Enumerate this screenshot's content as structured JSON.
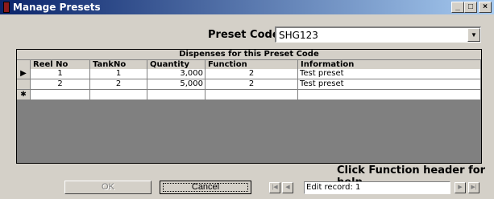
{
  "window": {
    "title": "Manage Presets",
    "controls": {
      "minimize": "_",
      "maximize": "□",
      "close": "×"
    }
  },
  "preset": {
    "label": "Preset Code",
    "value": "SHG123"
  },
  "grid": {
    "caption": "Dispenses for this Preset Code",
    "columns": [
      "Reel No",
      "TankNo",
      "Quantity",
      "Function",
      "Information"
    ],
    "rows": [
      {
        "indicator": "▶",
        "reel_no": "1",
        "tank_no": "1",
        "quantity": "3,000",
        "function": "2",
        "information": "Test preset"
      },
      {
        "indicator": "",
        "reel_no": "2",
        "tank_no": "2",
        "quantity": "5,000",
        "function": "2",
        "information": "Test preset"
      }
    ],
    "new_row_indicator": "✱"
  },
  "help_text": "Click Function header for help",
  "buttons": {
    "ok": "OK",
    "cancel": "Cancel"
  },
  "navigator": {
    "first": "|◀",
    "prev": "◀",
    "record_text": "Edit record: 1",
    "next": "▶",
    "last": "▶|"
  }
}
